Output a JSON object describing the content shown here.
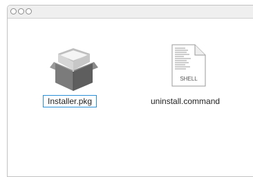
{
  "window": {
    "traffic_lights": [
      "close",
      "minimize",
      "zoom"
    ]
  },
  "files": [
    {
      "name": "Installer.pkg",
      "icon": "package-box-icon",
      "selected": true
    },
    {
      "name": "uninstall.command",
      "icon": "shell-script-icon",
      "badge": "SHELL",
      "selected": false
    }
  ],
  "colors": {
    "selection_border": "#2b8fd8",
    "titlebar": "#efefef"
  }
}
